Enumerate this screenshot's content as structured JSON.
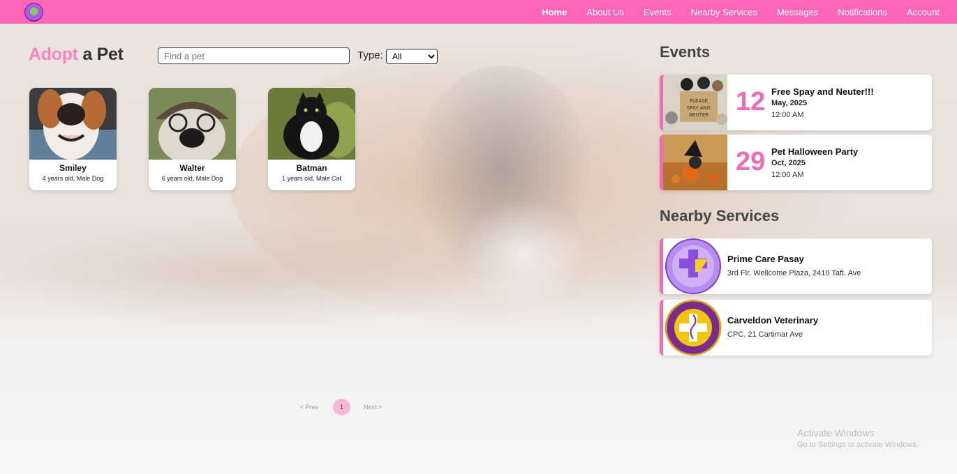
{
  "nav": {
    "items": [
      {
        "label": "Home",
        "active": true
      },
      {
        "label": "About Us"
      },
      {
        "label": "Events"
      },
      {
        "label": "Nearby Services"
      },
      {
        "label": "Messages"
      },
      {
        "label": "Notifications"
      },
      {
        "label": "Account"
      }
    ],
    "color": "#ff66b8"
  },
  "adopt": {
    "title_highlight": "Adopt",
    "title_rest": "a Pet",
    "search_placeholder": "Find a pet",
    "type_label": "Type:",
    "type_selected": "All",
    "pets": [
      {
        "name": "Smiley",
        "info": "4 years old, Male Dog",
        "photo": "dog-photo"
      },
      {
        "name": "Walter",
        "info": "6 years old, Male Dog",
        "photo": "dog-photo"
      },
      {
        "name": "Batman",
        "info": "1 years old, Male Cat",
        "photo": "cat-photo"
      }
    ]
  },
  "pagination": {
    "prev": "< Prev",
    "current": "1",
    "next": "Next >"
  },
  "events": {
    "heading": "Events",
    "items": [
      {
        "day": "12",
        "title": "Free Spay and Neuter!!!",
        "month": "May, 2025",
        "time": "12:00 AM"
      },
      {
        "day": "29",
        "title": "Pet Halloween Party",
        "month": "Oct, 2025",
        "time": "12:00 AM"
      }
    ]
  },
  "services": {
    "heading": "Nearby Services",
    "items": [
      {
        "name": "Prime Care Pasay",
        "address": "3rd Flr. Wellcome Plaza, 2410 Taft. Ave"
      },
      {
        "name": "Carveldon Veterinary",
        "address": "CPC, 21 Cartimar Ave"
      }
    ]
  },
  "watermark": {
    "line1": "Activate Windows",
    "line2": "Go to Settings to activate Windows."
  },
  "accent_color": "#f06bb7"
}
